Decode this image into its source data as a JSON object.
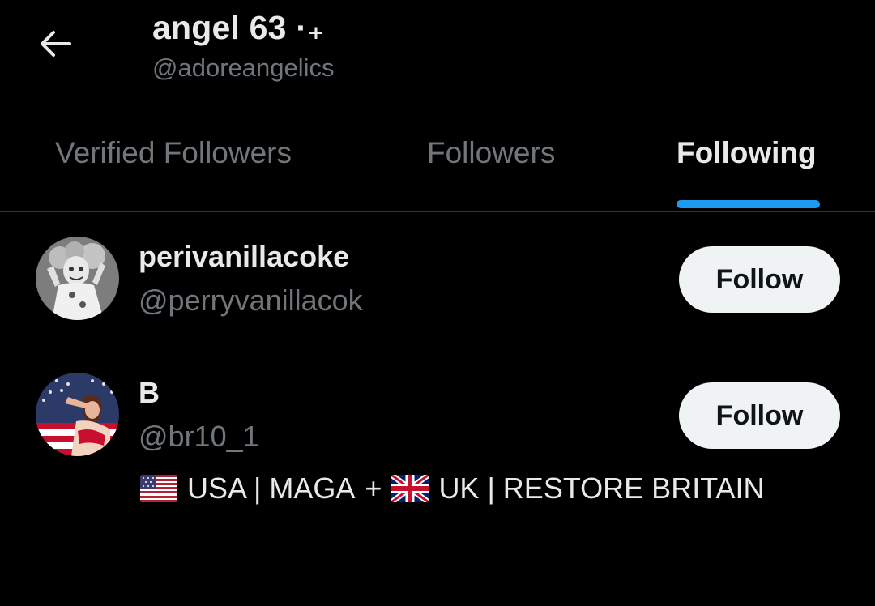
{
  "header": {
    "title": "angel 63 ·₊",
    "handle": "@adoreangelics"
  },
  "tabs": [
    {
      "label": "Verified Followers",
      "active": false
    },
    {
      "label": "Followers",
      "active": false
    },
    {
      "label": "Following",
      "active": true
    }
  ],
  "colors": {
    "accent": "#1d9bf0",
    "background": "#000000",
    "secondary_text": "#71767b",
    "primary_text": "#e7e9ea",
    "button_bg": "#eff3f4"
  },
  "users": [
    {
      "name": "perivanillacoke",
      "handle": "@perryvanillacok",
      "button_label": "Follow",
      "avatar_icon": "clown-avatar",
      "bio": null
    },
    {
      "name": "B",
      "handle": "@br10_1",
      "button_label": "Follow",
      "avatar_icon": "flag-salute-avatar",
      "bio": {
        "flag1_icon": "us-flag-icon",
        "part1": "USA | MAGA",
        "plus": "+",
        "flag2_icon": "uk-flag-icon",
        "part2": "UK | RESTORE BRITAIN"
      }
    }
  ]
}
